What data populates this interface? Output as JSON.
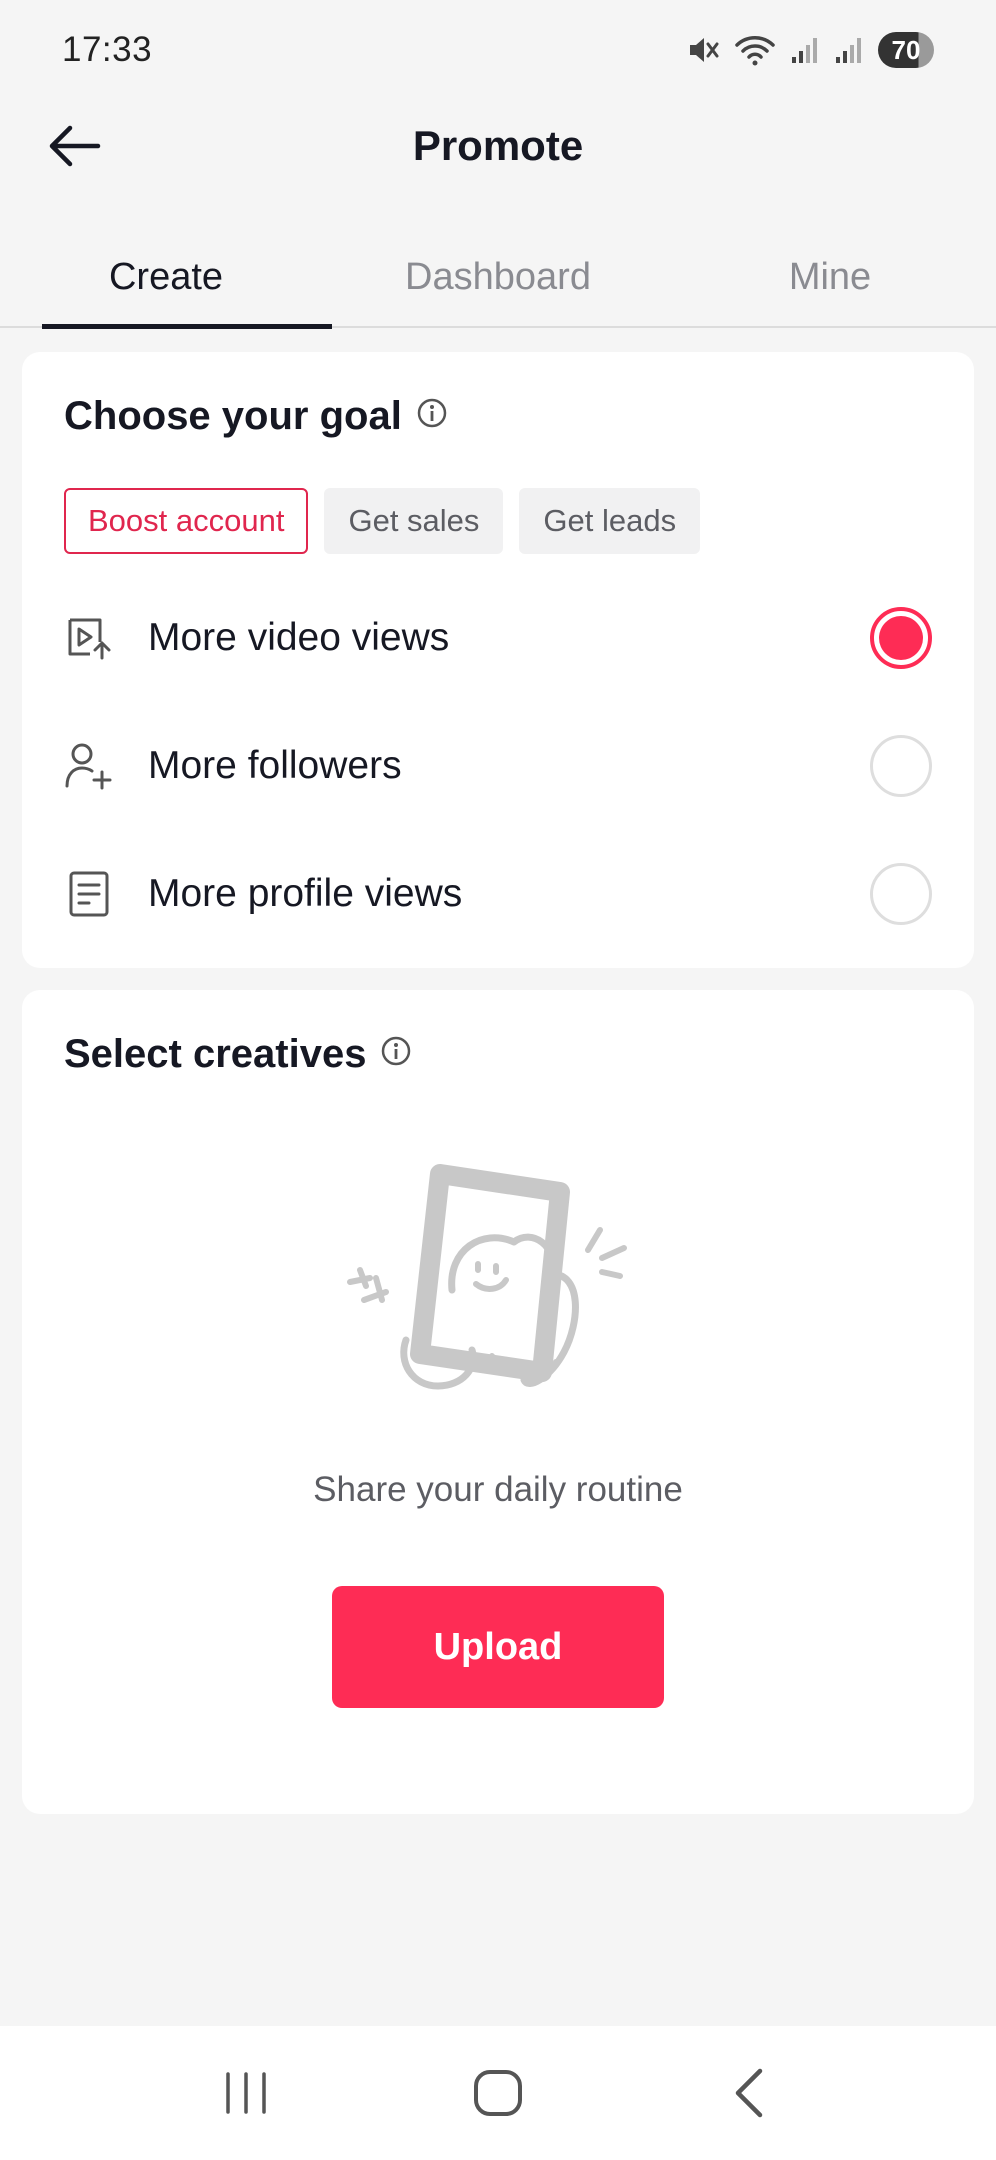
{
  "status_bar": {
    "time": "17:33",
    "battery": "70"
  },
  "header": {
    "title": "Promote"
  },
  "tabs": [
    {
      "label": "Create",
      "active": true
    },
    {
      "label": "Dashboard",
      "active": false
    },
    {
      "label": "Mine",
      "active": false
    }
  ],
  "goal": {
    "title": "Choose your goal",
    "chips": [
      {
        "label": "Boost account",
        "active": true
      },
      {
        "label": "Get sales",
        "active": false
      },
      {
        "label": "Get leads",
        "active": false
      }
    ],
    "options": [
      {
        "label": "More video views",
        "icon": "video-views-icon",
        "selected": true
      },
      {
        "label": "More followers",
        "icon": "add-follower-icon",
        "selected": false
      },
      {
        "label": "More profile views",
        "icon": "profile-doc-icon",
        "selected": false
      }
    ]
  },
  "creatives": {
    "title": "Select creatives",
    "empty_text": "Share your daily routine",
    "upload_label": "Upload"
  },
  "colors": {
    "accent": "#fe2c55",
    "chip_active": "#e0264e",
    "text": "#161823",
    "muted": "#8a8b91"
  }
}
